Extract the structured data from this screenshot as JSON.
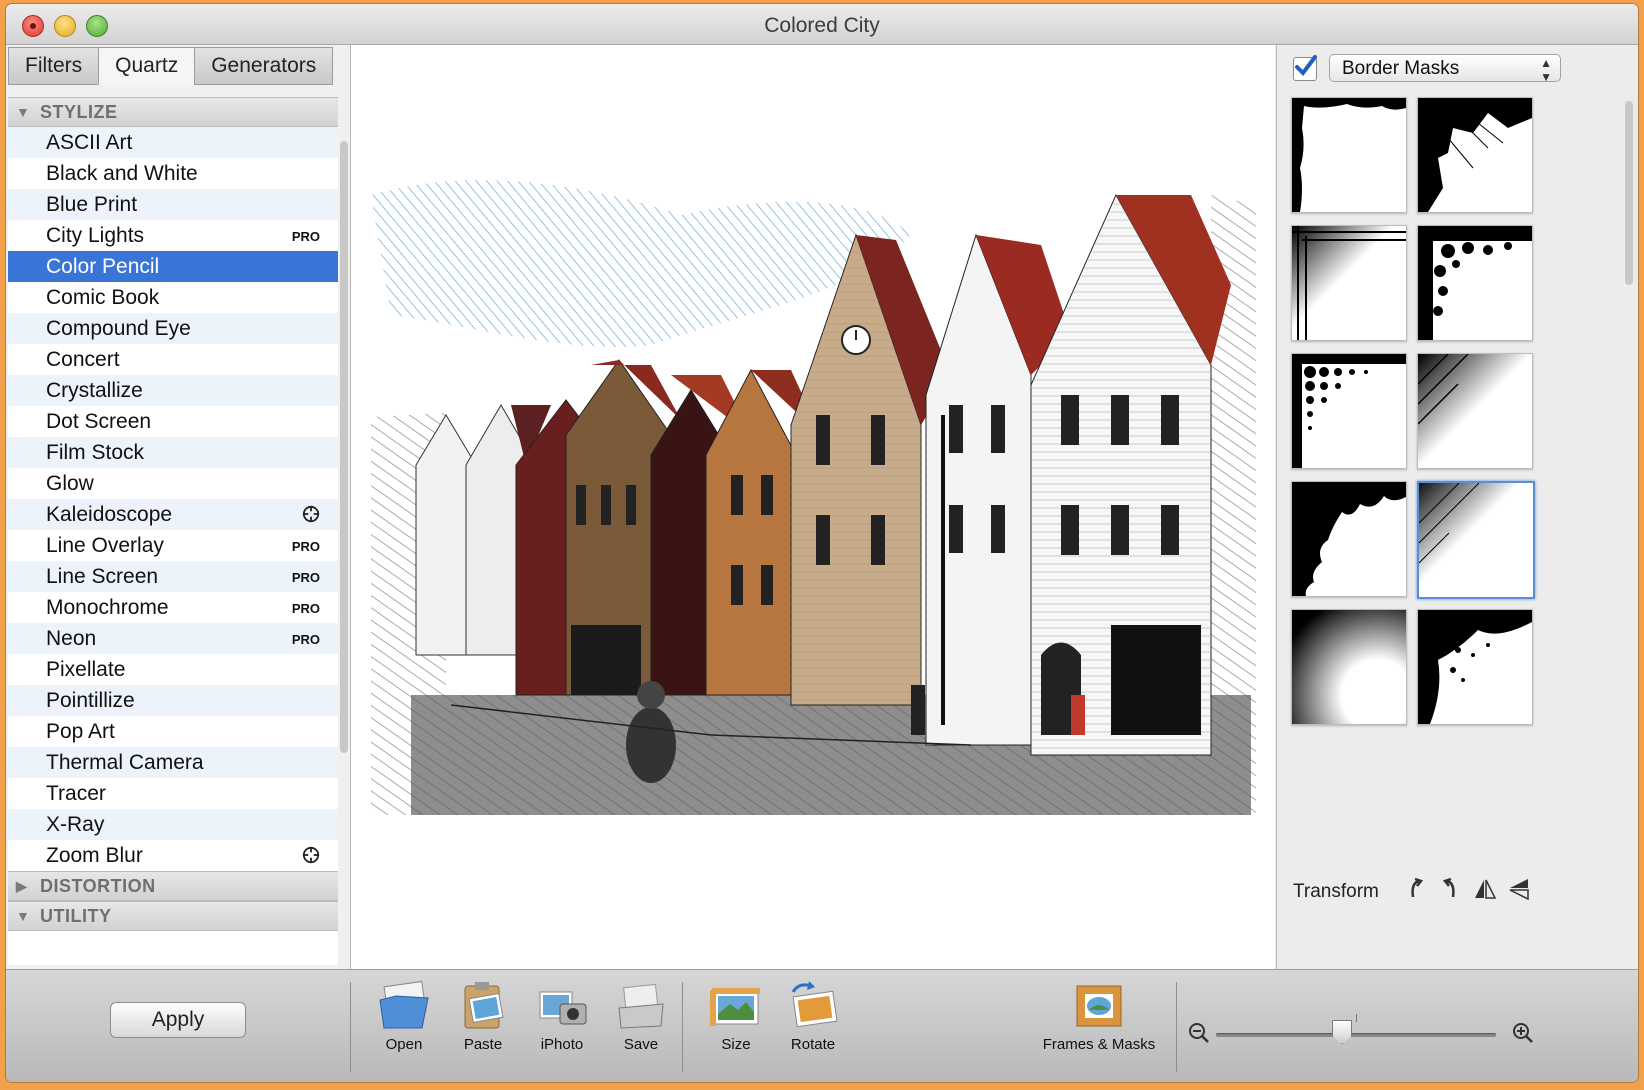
{
  "window": {
    "title": "Colored City"
  },
  "tabs": [
    {
      "label": "Filters"
    },
    {
      "label": "Quartz"
    },
    {
      "label": "Generators"
    }
  ],
  "categories": {
    "stylize": "STYLIZE",
    "distortion": "DISTORTION",
    "utility": "UTILITY"
  },
  "filters": [
    {
      "label": "ASCII Art",
      "badge": ""
    },
    {
      "label": "Black and White",
      "badge": ""
    },
    {
      "label": "Blue Print",
      "badge": ""
    },
    {
      "label": "City Lights",
      "badge": "PRO"
    },
    {
      "label": "Color Pencil",
      "badge": ""
    },
    {
      "label": "Comic Book",
      "badge": ""
    },
    {
      "label": "Compound Eye",
      "badge": ""
    },
    {
      "label": "Concert",
      "badge": ""
    },
    {
      "label": "Crystallize",
      "badge": ""
    },
    {
      "label": "Dot Screen",
      "badge": ""
    },
    {
      "label": "Film Stock",
      "badge": ""
    },
    {
      "label": "Glow",
      "badge": ""
    },
    {
      "label": "Kaleidoscope",
      "badge": ""
    },
    {
      "label": "Line Overlay",
      "badge": "PRO"
    },
    {
      "label": "Line Screen",
      "badge": "PRO"
    },
    {
      "label": "Monochrome",
      "badge": "PRO"
    },
    {
      "label": "Neon",
      "badge": "PRO"
    },
    {
      "label": "Pixellate",
      "badge": ""
    },
    {
      "label": "Pointillize",
      "badge": ""
    },
    {
      "label": "Pop Art",
      "badge": ""
    },
    {
      "label": "Thermal Camera",
      "badge": ""
    },
    {
      "label": "Tracer",
      "badge": ""
    },
    {
      "label": "X-Ray",
      "badge": ""
    },
    {
      "label": "Zoom Blur",
      "badge": ""
    }
  ],
  "selected_filter": "Color Pencil",
  "right": {
    "checkbox_checked": true,
    "mask_type": "Border Masks",
    "transform_label": "Transform",
    "selected_mask": "mask-8"
  },
  "toolbar": {
    "apply": "Apply",
    "open": "Open",
    "paste": "Paste",
    "iphoto": "iPhoto",
    "save": "Save",
    "size": "Size",
    "rotate": "Rotate",
    "frames": "Frames & Masks"
  },
  "zoom": {
    "level_fraction": 0.45
  },
  "colors": {
    "selection": "#3875d7",
    "accent_window": "#f2a14b"
  }
}
